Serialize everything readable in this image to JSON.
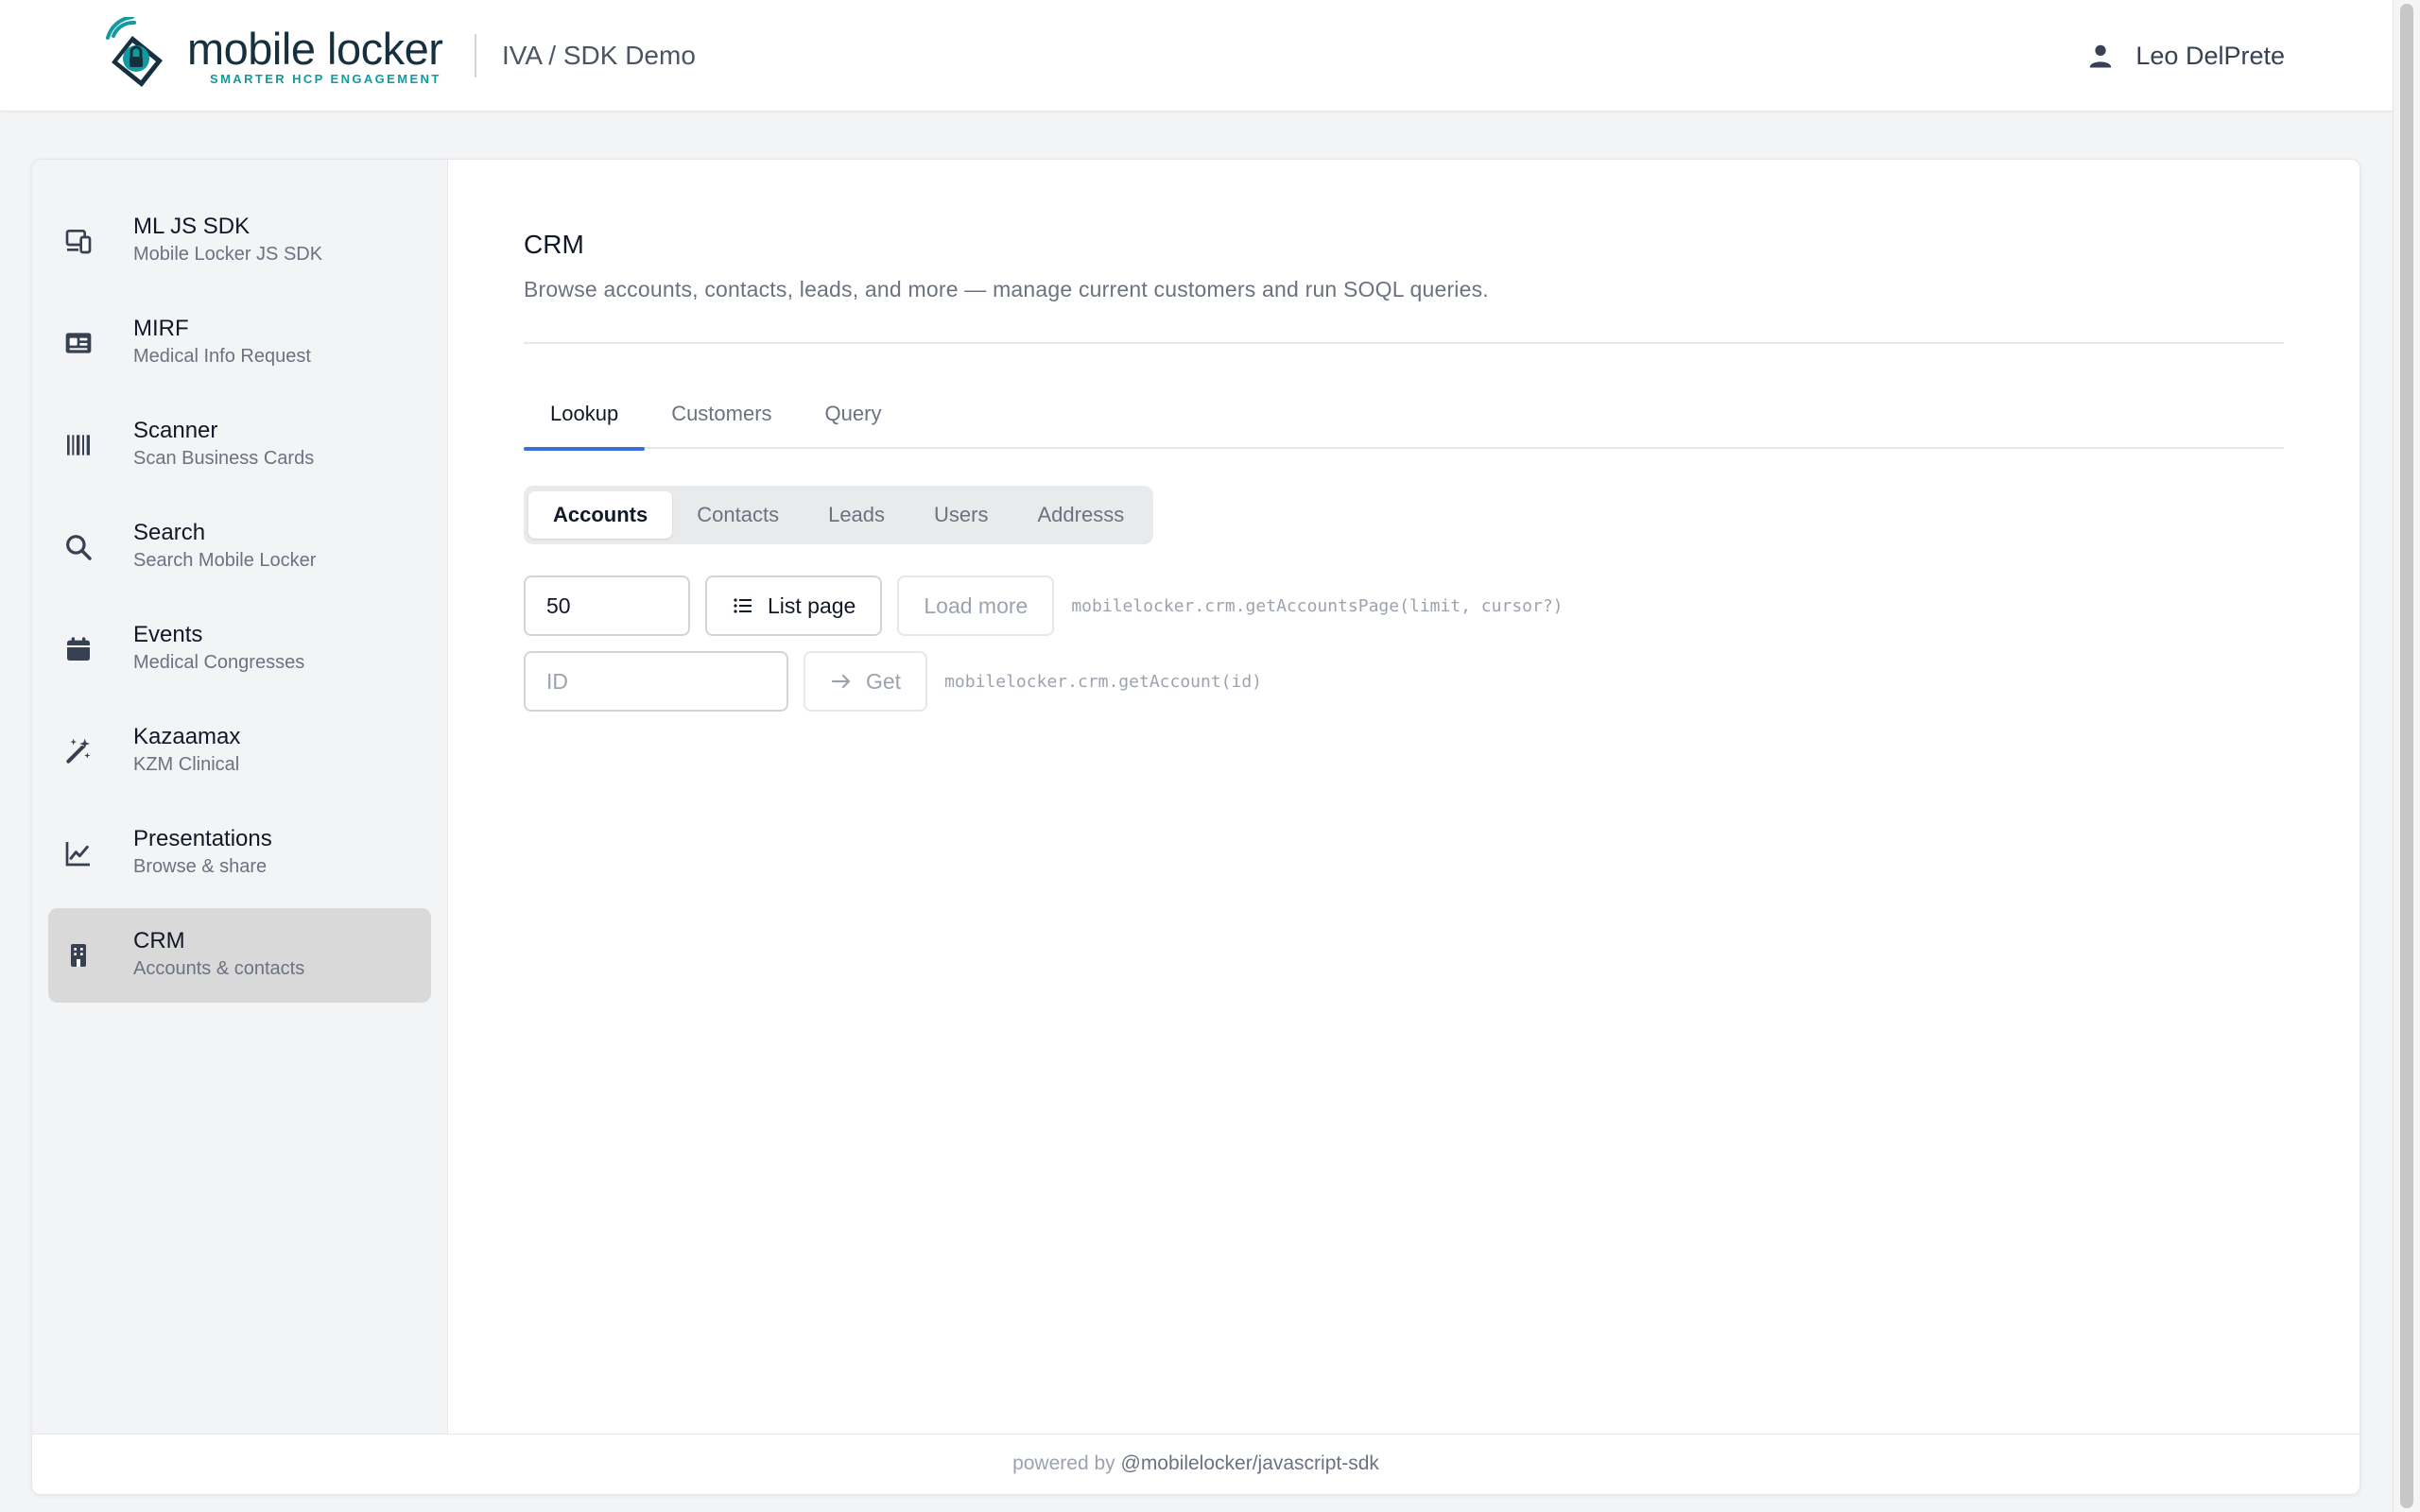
{
  "header": {
    "logo_name": "mobile locker",
    "logo_tagline": "SMARTER HCP ENGAGEMENT",
    "app_title": "IVA / SDK Demo",
    "user_name": "Leo DelPrete"
  },
  "sidebar": {
    "items": [
      {
        "title": "ML JS SDK",
        "subtitle": "Mobile Locker JS SDK",
        "icon": "devices-icon"
      },
      {
        "title": "MIRF",
        "subtitle": "Medical Info Request",
        "icon": "id-card-icon"
      },
      {
        "title": "Scanner",
        "subtitle": "Scan Business Cards",
        "icon": "barcode-icon"
      },
      {
        "title": "Search",
        "subtitle": "Search Mobile Locker",
        "icon": "search-icon"
      },
      {
        "title": "Events",
        "subtitle": "Medical Congresses",
        "icon": "calendar-icon"
      },
      {
        "title": "Kazaamax",
        "subtitle": "KZM Clinical",
        "icon": "magic-wand-icon"
      },
      {
        "title": "Presentations",
        "subtitle": "Browse & share",
        "icon": "line-chart-icon"
      },
      {
        "title": "CRM",
        "subtitle": "Accounts & contacts",
        "icon": "building-icon",
        "active": true
      }
    ]
  },
  "main": {
    "title": "CRM",
    "description": "Browse accounts, contacts, leads, and more — manage current customers and run SOQL queries.",
    "tabs": [
      {
        "label": "Lookup",
        "active": true
      },
      {
        "label": "Customers"
      },
      {
        "label": "Query"
      }
    ],
    "segments": [
      {
        "label": "Accounts",
        "active": true
      },
      {
        "label": "Contacts"
      },
      {
        "label": "Leads"
      },
      {
        "label": "Users"
      },
      {
        "label": "Addresss"
      }
    ],
    "limit_value": "50",
    "list_page_label": "List page",
    "load_more_label": "Load more",
    "list_code": "mobilelocker.crm.getAccountsPage(limit, cursor?)",
    "id_placeholder": "ID",
    "get_label": "Get",
    "get_code": "mobilelocker.crm.getAccount(id)"
  },
  "footer": {
    "prefix": "powered by",
    "package": "@mobilelocker/javascript-sdk"
  },
  "colors": {
    "accent": "#3b6fd8",
    "logo_teal": "#119aa0",
    "logo_dark": "#15303f",
    "active_nav_bg": "#d9d9d9"
  }
}
